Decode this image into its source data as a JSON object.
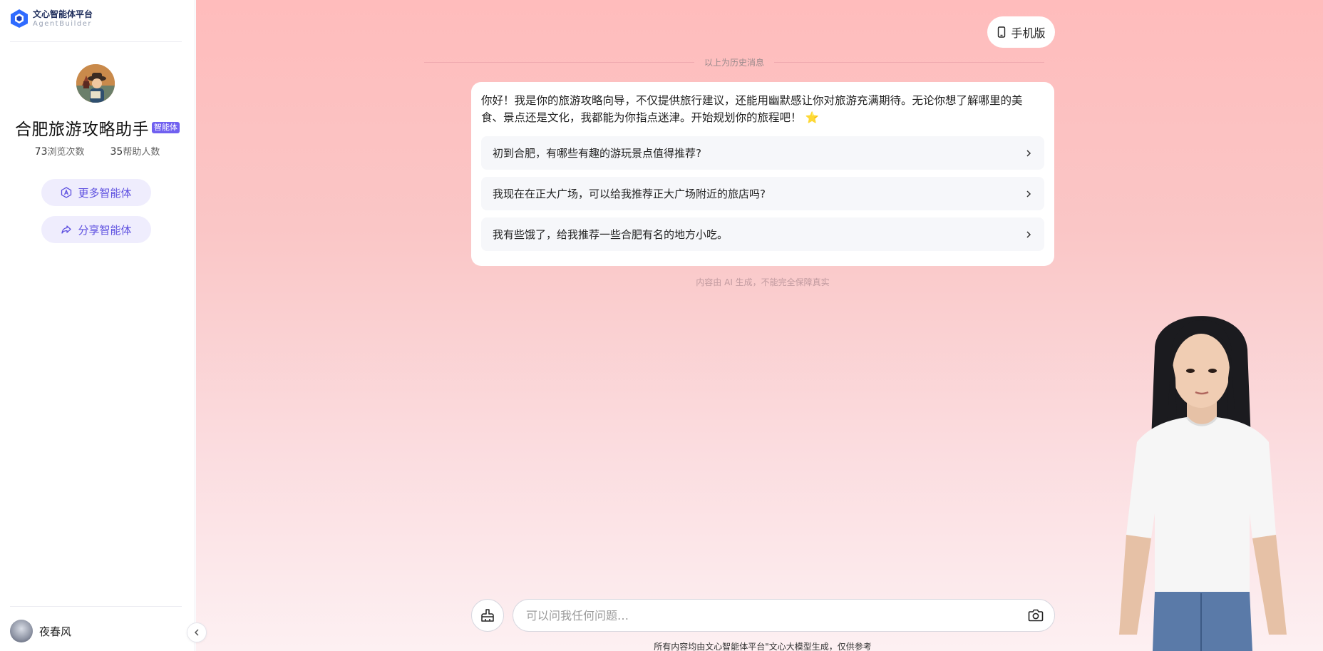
{
  "app": {
    "logo_name": "文心智能体平台",
    "logo_sub": "AgentBuilder"
  },
  "agent": {
    "name": "合肥旅游攻略助手",
    "badge": "智能体",
    "views_count": "73",
    "views_label": "浏览次数",
    "helped_count": "35",
    "helped_label": "帮助人数"
  },
  "sidebar": {
    "more_agents_label": "更多智能体",
    "share_agent_label": "分享智能体"
  },
  "user": {
    "name": "夜春风"
  },
  "header": {
    "mobile_label": "手机版"
  },
  "chat": {
    "history_divider": "以上为历史消息",
    "welcome_text": "你好！我是你的旅游攻略向导，不仅提供旅行建议，还能用幽默感让你对旅游充满期待。无论你想了解哪里的美食、景点还是文化，我都能为你指点迷津。开始规划你的旅程吧！",
    "welcome_emoji": "⭐",
    "suggestions": [
      "初到合肥，有哪些有趣的游玩景点值得推荐?",
      "我现在在正大广场，可以给我推荐正大广场附近的旅店吗?",
      "我有些饿了，给我推荐一些合肥有名的地方小吃。"
    ],
    "ai_note": "内容由 AI 生成，不能完全保障真实"
  },
  "input": {
    "placeholder": "可以问我任何问题…",
    "footer_note": "所有内容均由文心智能体平台\"文心大模型生成，仅供参考"
  },
  "icons": {
    "logo": "agentbuilder-logo-icon",
    "more": "agent-a-icon",
    "share": "share-arrow-icon",
    "mobile": "phone-icon",
    "chevron": "chevron-right-icon",
    "collapse": "chevron-left-icon",
    "clear": "broom-icon",
    "camera": "camera-icon"
  },
  "colors": {
    "accent": "#5d4fe0",
    "badge": "#7060f0",
    "main_bg_top": "#ffbcbc",
    "main_bg_bottom": "#fdf0f2"
  }
}
